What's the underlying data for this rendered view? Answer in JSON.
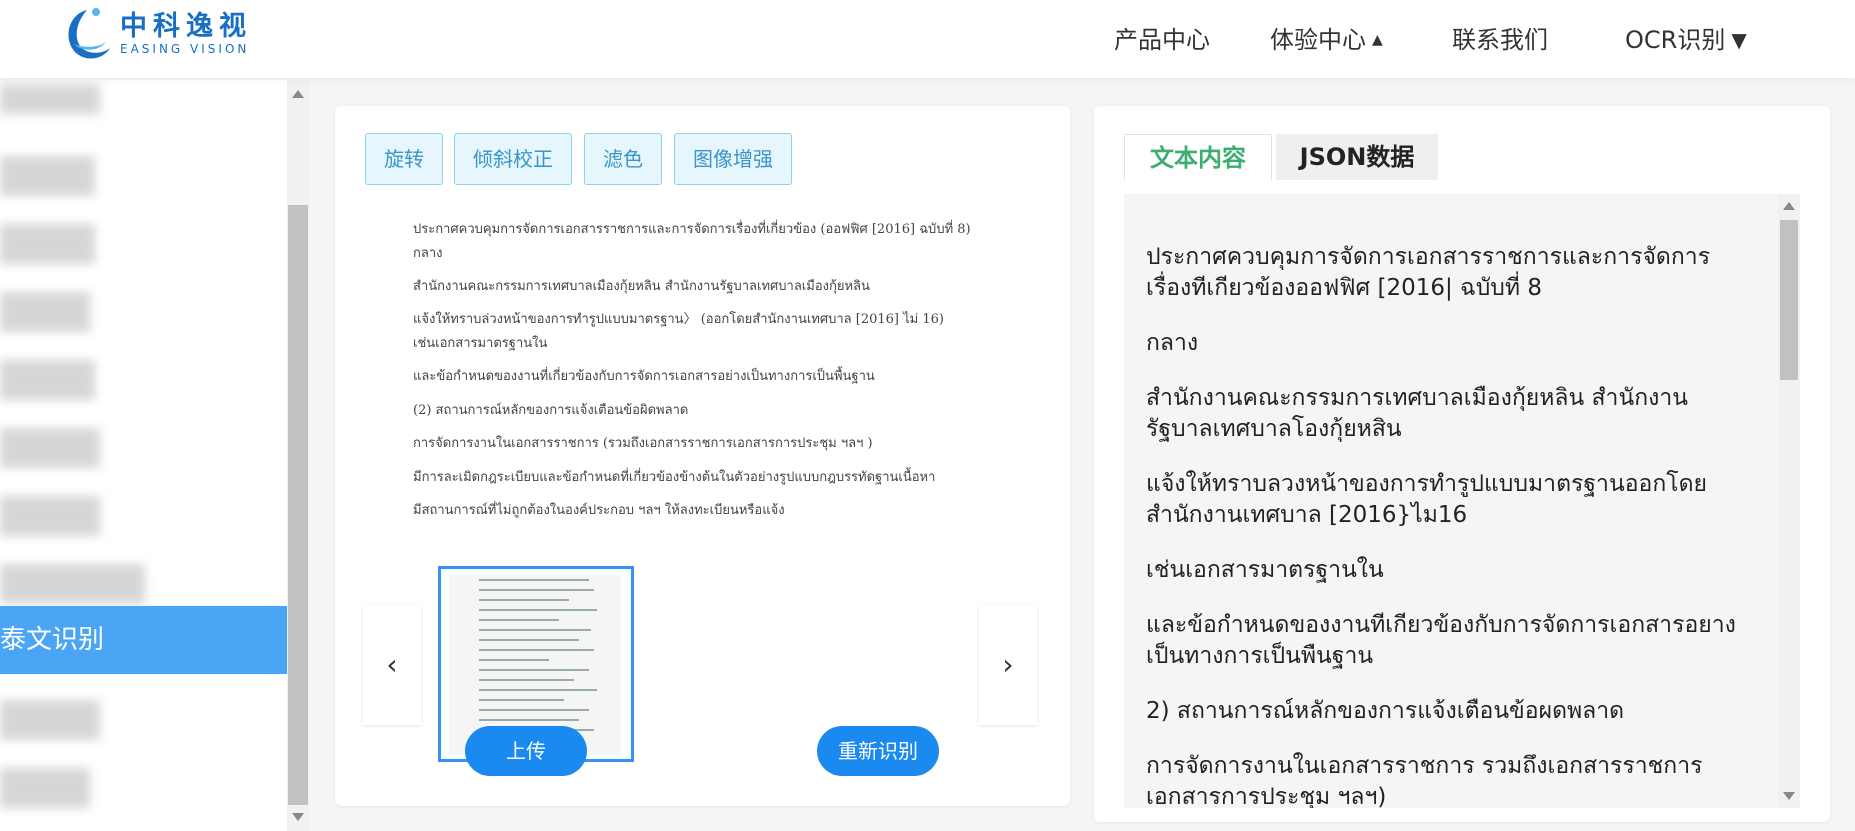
{
  "header": {
    "logo_cn": "中科逸视",
    "logo_en": "EASING VISION",
    "nav": [
      {
        "label": "产品中心",
        "arrow": ""
      },
      {
        "label": "体验中心",
        "arrow": "▲"
      },
      {
        "label": "联系我们",
        "arrow": ""
      },
      {
        "label": "OCR识别",
        "arrow": "▼"
      }
    ]
  },
  "sidebar": {
    "active_label": "泰文识别"
  },
  "toolbar": {
    "rotate": "旋转",
    "deskew": "倾斜校正",
    "filter": "滤色",
    "enhance": "图像增强"
  },
  "document": {
    "lines": [
      "ประกาศควบคุมการจัดการเอกสารราชการและการจัดการเรื่องที่เกี่ยวข้อง (ออฟฟิศ [2016] ฉบับที่ 8)",
      "กลาง",
      "สำนักงานคณะกรรมการเทศบาลเมืองกุ้ยหลิน สำนักงานรัฐบาลเทศบาลเมืองกุ้ยหลิน",
      "แจ้งให้ทราบล่วงหน้าของการทำรูปแบบมาตรฐาน〉 (ออกโดยสำนักงานเทศบาล [2016] ไม่ 16)",
      "เช่นเอกสารมาตรฐานใน",
      "และข้อกำหนดของงานที่เกี่ยวข้องกับการจัดการเอกสารอย่างเป็นทางการเป็นพื้นฐาน",
      "(2) สถานการณ์หลักของการแจ้งเตือนข้อผิดพลาด",
      "การจัดการงานในเอกสารราชการ (รวมถึงเอกสารราชการเอกสารการประชุม ฯลฯ )",
      "มีการละเมิดกฎระเบียบและข้อกำหนดที่เกี่ยวข้องข้างต้นในตัวอย่างรูปแบบกฎบรรทัดฐานเนื้อหา",
      "มีสถานการณ์ที่ไม่ถูกต้องในองค์ประกอบ ฯลฯ ให้ลงทะเบียนหรือแจ้ง"
    ]
  },
  "carousel": {
    "prev_icon": "‹",
    "next_icon": "›"
  },
  "actions": {
    "upload": "上传",
    "reocr": "重新识别"
  },
  "result": {
    "tabs": [
      "文本内容",
      "JSON数据"
    ],
    "paragraphs": [
      "ประกาศควบคุมการจัดการเอกสารราชการและการจัดการเรื่องทีเกียวข้องออฟฟิศ [2016| ฉบับที่ 8",
      "กลาง",
      "สำนักงานคณะกรรมการเทศบาลเมืองกุ้ยหลิน สำนักงานรัฐบาลเทศบาลโองกุ้ยหสิน",
      "แจ้งให้ทราบลวงหน้าของการทำรูปแบบมาตรฐานออกโดยสำนักงานเทศบาล [2016}ไม16",
      "เช่นเอกสารมาตรฐานใน",
      "และข้อกำหนดของงานทีเกียวข้องกับการจัดการเอกสารอยางเป็นทางการเป็นพืนฐาน",
      "2) สถานการณ์หลักของการแจ้งเตือนข้อผดพลาด",
      "การจัดการงานในเอกสารราชการ รวมถึงเอกสารราชการเอกสารการประชุม ฯลฯ)"
    ]
  }
}
